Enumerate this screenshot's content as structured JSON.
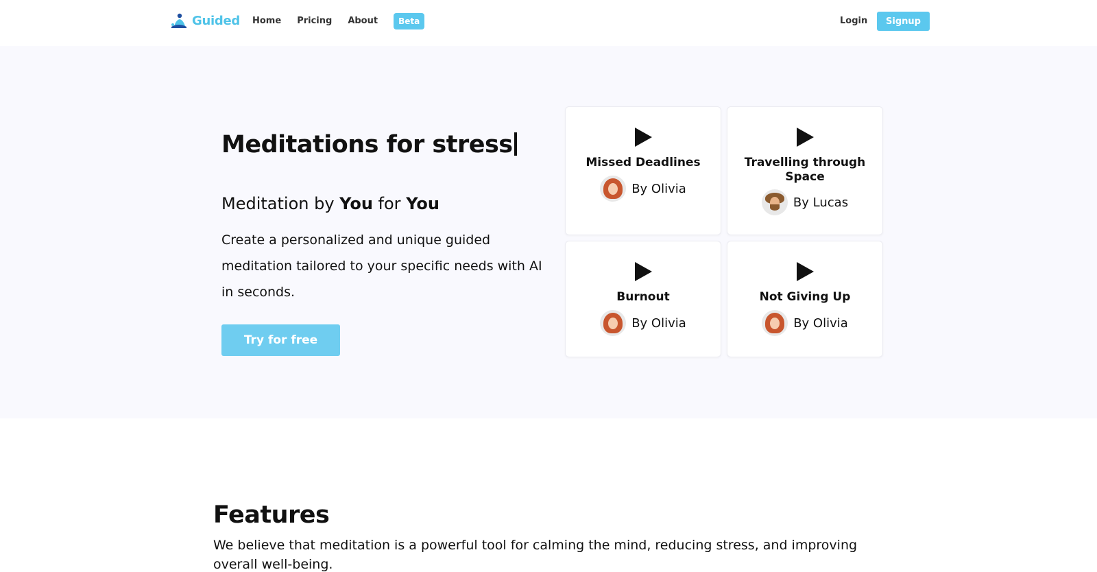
{
  "nav": {
    "logo_text": "Guided",
    "links": [
      "Home",
      "Pricing",
      "About"
    ],
    "beta_label": "Beta",
    "login_label": "Login",
    "signup_label": "Signup"
  },
  "hero": {
    "title": "Meditations for stress",
    "subtitle_prefix": "Meditation by ",
    "subtitle_you1": "You",
    "subtitle_mid": " for ",
    "subtitle_you2": "You",
    "description": "Create a personalized and unique guided meditation tailored to your specific needs with AI in seconds.",
    "cta_label": "Try for free"
  },
  "cards": [
    {
      "title": "Missed Deadlines",
      "author": "By Olivia",
      "avatar": "olivia-avatar"
    },
    {
      "title": "Travelling through Space",
      "author": "By Lucas",
      "avatar": "lucas-avatar"
    },
    {
      "title": "Burnout",
      "author": "By Olivia",
      "avatar": "olivia-avatar"
    },
    {
      "title": "Not Giving Up",
      "author": "By Olivia",
      "avatar": "olivia-avatar"
    }
  ],
  "features": {
    "title": "Features",
    "description": "We believe that meditation is a powerful tool for calming the mind, reducing stress, and improving overall well-being."
  },
  "colors": {
    "accent": "#5bc8ee",
    "hero_bg": "#f9f9fe"
  },
  "icons": {
    "logo": "meditating-figure-icon",
    "card_action": "play-icon"
  }
}
